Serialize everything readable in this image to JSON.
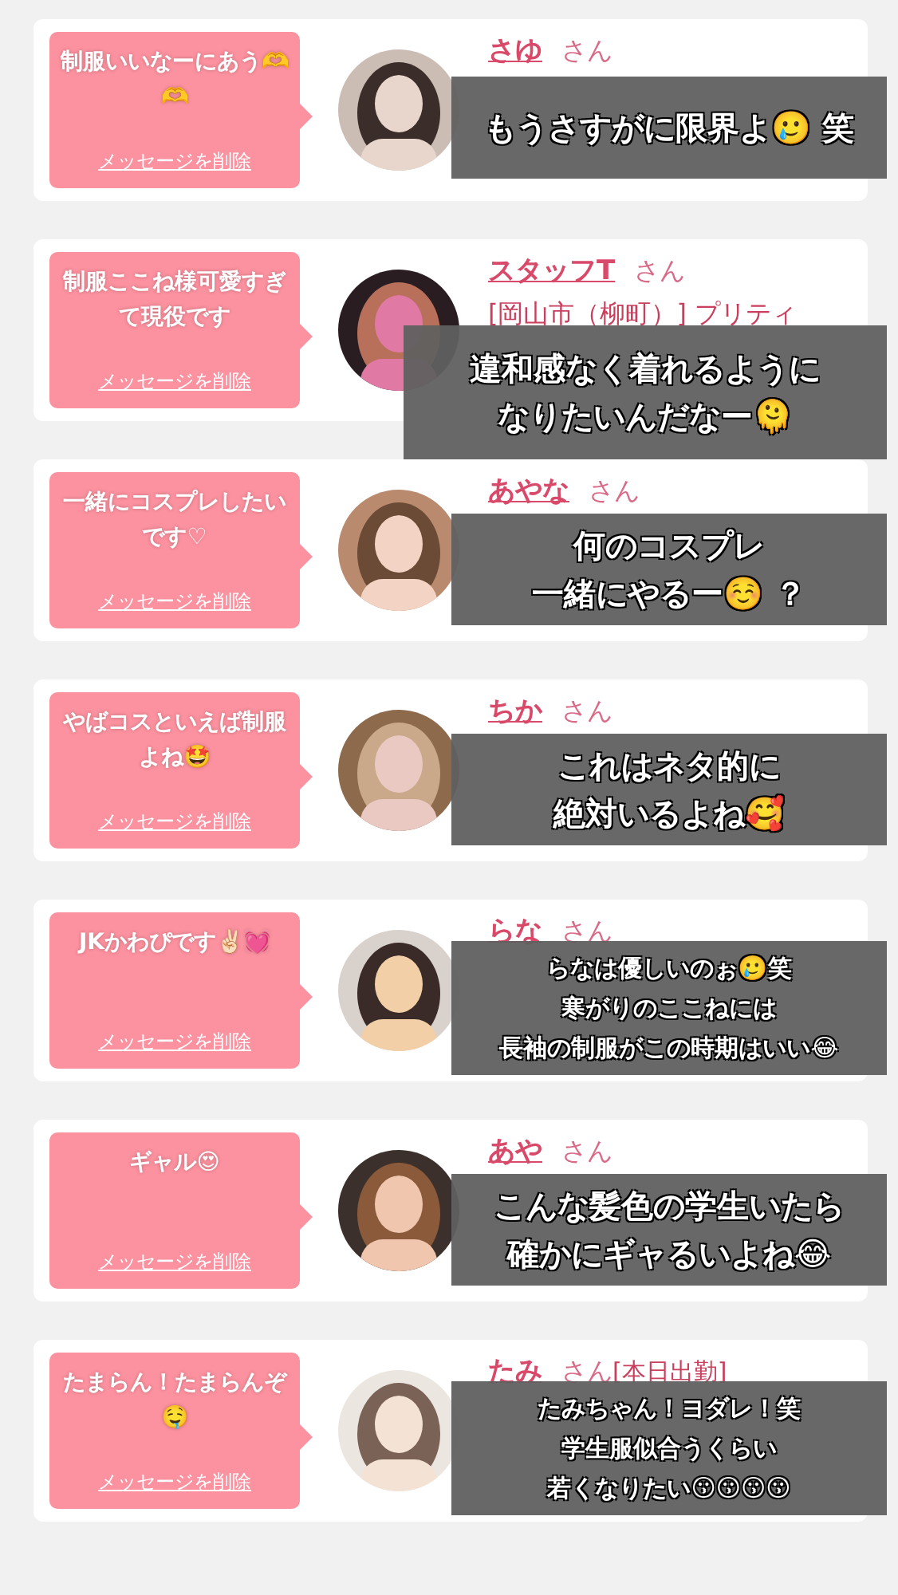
{
  "messages": [
    {
      "message": "制服いいなーにあう🫶🫶",
      "delete_link": "メッセージを削除",
      "name": "さゆ",
      "honorific": "さん",
      "caption": [
        "もうさすがに限界よ🥲 笑"
      ]
    },
    {
      "message": "制服ここね様可愛すぎて現役です",
      "delete_link": "メッセージを削除",
      "name": "スタッフT",
      "honorific": "さん",
      "store": "[岡山市（柳町）] プリティ",
      "caption": [
        "違和感なく着れるように",
        "なりたいんだなー🫠"
      ]
    },
    {
      "message": "一緒にコスプレしたいです♡",
      "delete_link": "メッセージを削除",
      "name": "あやな",
      "honorific": "さん",
      "caption": [
        "何のコスプレ",
        "一緒にやるー☺️ ？"
      ]
    },
    {
      "message": "やばコスといえば制服よね🤩",
      "delete_link": "メッセージを削除",
      "name": "ちか",
      "honorific": "さん",
      "caption": [
        "これはネタ的に",
        "絶対いるよね🥰"
      ]
    },
    {
      "message": "JKかわぴです✌🏻💓",
      "delete_link": "メッセージを削除",
      "name": "らな",
      "honorific": "さん",
      "caption": [
        "らなは優しいのぉ🥲笑",
        "寒がりのここねには",
        "長袖の制服がこの時期はいい😂"
      ]
    },
    {
      "message": "ギャル😍",
      "delete_link": "メッセージを削除",
      "name": "あや",
      "honorific": "さん",
      "caption": [
        "こんな髪色の学生いたら",
        "確かにギャるいよね😂"
      ]
    },
    {
      "message": "たまらん！たまらんぞ🤤",
      "delete_link": "メッセージを削除",
      "name": "たみ",
      "honorific": "さん",
      "tag": "[本日出勤]",
      "caption": [
        "たみちゃん！ヨダレ！笑",
        "学生服似合うくらい",
        "若くなりたい😗😗😗😗"
      ]
    }
  ]
}
